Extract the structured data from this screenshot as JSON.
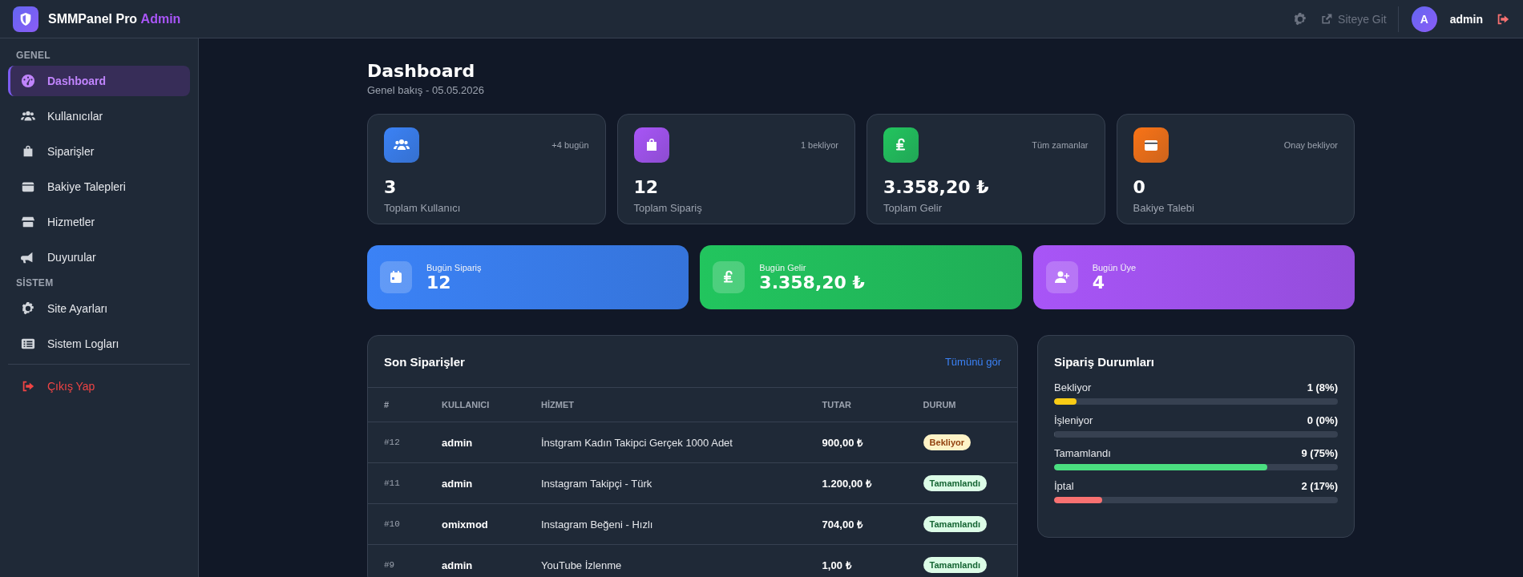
{
  "header": {
    "brand": "SMMPanel Pro",
    "brand_accent": "Admin",
    "site_link": "Siteye Git",
    "avatar_letter": "A",
    "user": "admin"
  },
  "sidebar": {
    "sections": [
      {
        "title": "GENEL",
        "items": [
          {
            "label": "Dashboard",
            "selected": true
          },
          {
            "label": "Kullanıcılar",
            "selected": false
          },
          {
            "label": "Siparişler",
            "selected": false
          },
          {
            "label": "Bakiye Talepleri",
            "selected": false
          },
          {
            "label": "Hizmetler",
            "selected": false
          },
          {
            "label": "Duyurular",
            "selected": false
          }
        ]
      },
      {
        "title": "SİSTEM",
        "items": [
          {
            "label": "Site Ayarları",
            "selected": false
          },
          {
            "label": "Sistem Logları",
            "selected": false
          }
        ]
      }
    ],
    "logout": "Çıkış Yap"
  },
  "page": {
    "title": "Dashboard",
    "subtitle": "Genel bakış - 05.05.2026"
  },
  "stats": [
    {
      "value": "3",
      "label": "Toplam Kullanıcı",
      "note": "+4 bugün",
      "color": "#3b82f6"
    },
    {
      "value": "12",
      "label": "Toplam Sipariş",
      "note": "1 bekliyor",
      "color": "#a855f7"
    },
    {
      "value": "3.358,20 ₺",
      "label": "Toplam Gelir",
      "note": "Tüm zamanlar",
      "color": "#22c55e"
    },
    {
      "value": "0",
      "label": "Bakiye Talebi",
      "note": "Onay bekliyor",
      "color": "#f97316"
    }
  ],
  "today": [
    {
      "label": "Bugün Sipariş",
      "value": "12",
      "color": "#3b82f6"
    },
    {
      "label": "Bugün Gelir",
      "value": "3.358,20 ₺",
      "color": "#22c55e"
    },
    {
      "label": "Bugün Üye",
      "value": "4",
      "color": "#a855f7"
    }
  ],
  "orders": {
    "title": "Son Siparişler",
    "link": "Tümünü gör",
    "columns": [
      "#",
      "KULLANICI",
      "HİZMET",
      "TUTAR",
      "DURUM"
    ],
    "rows": [
      {
        "id": "#12",
        "user": "admin",
        "service": "İnstgram Kadın Takipci Gerçek 1000 Adet",
        "amount": "900,00 ₺",
        "status": "Bekliyor",
        "kind": "pending"
      },
      {
        "id": "#11",
        "user": "admin",
        "service": "Instagram Takipçi - Türk",
        "amount": "1.200,00 ₺",
        "status": "Tamamlandı",
        "kind": "completed"
      },
      {
        "id": "#10",
        "user": "omixmod",
        "service": "Instagram Beğeni - Hızlı",
        "amount": "704,00 ₺",
        "status": "Tamamlandı",
        "kind": "completed"
      },
      {
        "id": "#9",
        "user": "admin",
        "service": "YouTube İzlenme",
        "amount": "1,00 ₺",
        "status": "Tamamlandı",
        "kind": "completed"
      }
    ]
  },
  "status_panel": {
    "title": "Sipariş Durumları",
    "items": [
      {
        "label": "Bekliyor",
        "reading": "1 (8%)",
        "level": 0.08,
        "color": "#facc15"
      },
      {
        "label": "İşleniyor",
        "reading": "0 (0%)",
        "level": 0
      },
      {
        "label": "Tamamlandı",
        "reading": "9 (75%)",
        "level": 0.75,
        "color": "#4ade80"
      },
      {
        "label": "İptal",
        "reading": "2 (17%)",
        "level": 0.17,
        "color": "#f87171"
      }
    ]
  }
}
